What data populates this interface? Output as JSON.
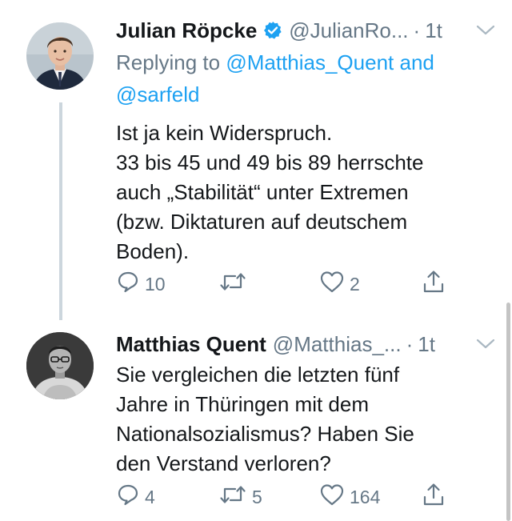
{
  "colors": {
    "text": "#14171a",
    "secondary": "#657786",
    "link": "#1da1f2",
    "verified": "#1da1f2",
    "thread_line": "#ccd6dd"
  },
  "tweets": [
    {
      "display_name": "Julian Röpcke",
      "verified": true,
      "handle": "@JulianRo...",
      "separator": "·",
      "time": "1t",
      "reply_prefix": "Replying to",
      "reply_mention_1": "@Matthias_Quent",
      "reply_and": "and",
      "reply_mention_2": "@sarfeld",
      "text_lines": [
        "Ist ja kein Widerspruch.",
        "33 bis 45 und 49 bis 89 herrschte",
        "auch „Stabilität“ unter Extremen",
        "(bzw. Diktaturen auf deutschem",
        "Boden)."
      ],
      "reply_count": "10",
      "retweet_count": "",
      "like_count": "2",
      "icons": [
        "reply-icon",
        "retweet-icon",
        "like-icon",
        "share-icon"
      ]
    },
    {
      "display_name": "Matthias Quent",
      "verified": false,
      "handle": "@Matthias_...",
      "separator": "·",
      "time": "1t",
      "text_lines": [
        "Sie vergleichen die letzten fünf",
        "Jahre in Thüringen mit dem",
        "Nationalsozialismus? Haben Sie",
        "den Verstand verloren?"
      ],
      "reply_count": "4",
      "retweet_count": "5",
      "like_count": "164",
      "icons": [
        "reply-icon",
        "retweet-icon",
        "like-icon",
        "share-icon"
      ]
    }
  ]
}
